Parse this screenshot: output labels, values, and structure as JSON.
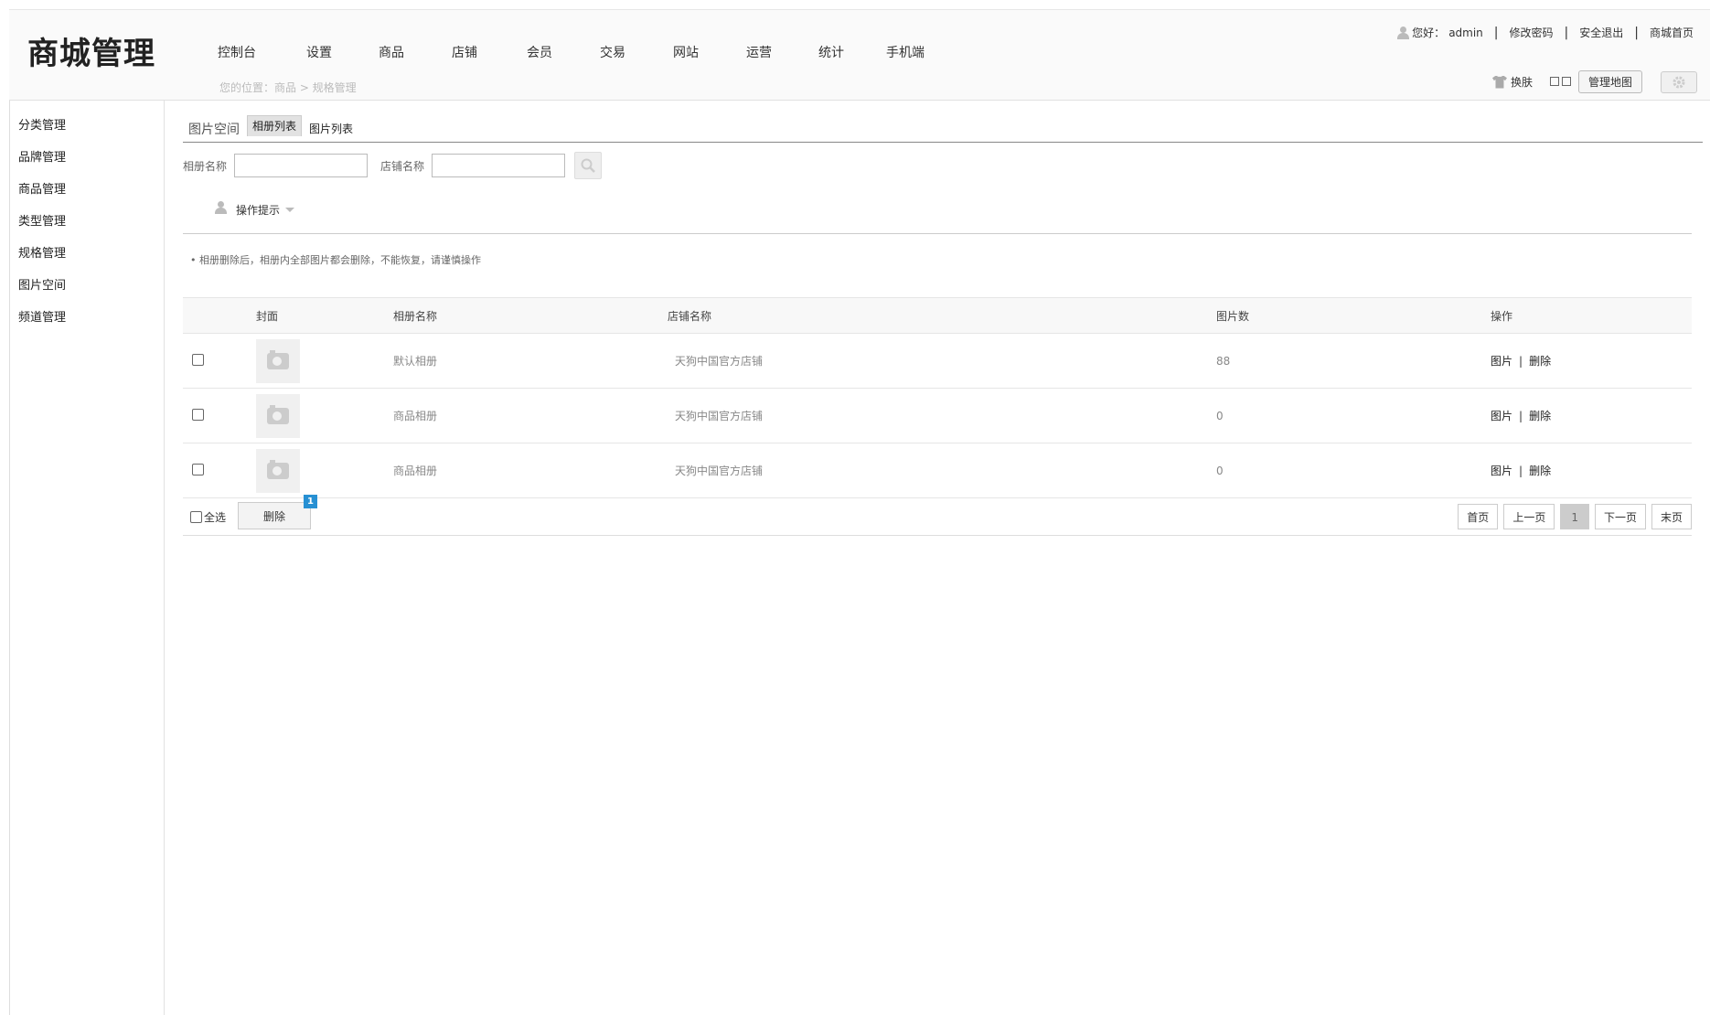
{
  "header": {
    "logo": "商城管理",
    "nav": [
      "控制台",
      "设置",
      "商品",
      "店铺",
      "会员",
      "交易",
      "网站",
      "运营",
      "统计",
      "手机端"
    ],
    "breadcrumb": "您的位置：商品 > 规格管理",
    "greeting": "您好：",
    "username": "admin",
    "change_password": "修改密码",
    "logout": "安全退出",
    "store_home": "商城首页",
    "skin_label": "换肤",
    "map_button": "管理地图"
  },
  "sidebar": {
    "items": [
      "分类管理",
      "品牌管理",
      "商品管理",
      "类型管理",
      "规格管理",
      "图片空间",
      "频道管理"
    ]
  },
  "main": {
    "section_title": "图片空间",
    "tabs": [
      "相册列表",
      "图片列表"
    ],
    "search": {
      "album_label": "相册名称",
      "store_label": "店铺名称",
      "album_value": "",
      "store_value": ""
    },
    "hint_title": "操作提示",
    "notice": "相册删除后，相册内全部图片都会删除，不能恢复，请谨慎操作",
    "table": {
      "headers": [
        "封面",
        "相册名称",
        "店铺名称",
        "图片数",
        "操作"
      ],
      "rows": [
        {
          "name": "默认相册",
          "store": "天狗中国官方店铺",
          "count": "88",
          "op_view": "图片",
          "op_delete": "删除"
        },
        {
          "name": "商品相册",
          "store": "天狗中国官方店铺",
          "count": "0",
          "op_view": "图片",
          "op_delete": "删除"
        },
        {
          "name": "商品相册",
          "store": "天狗中国官方店铺",
          "count": "0",
          "op_view": "图片",
          "op_delete": "删除"
        }
      ]
    },
    "footer": {
      "select_all": "全选",
      "delete": "删除",
      "badge": "1"
    },
    "pager": {
      "first": "首页",
      "prev": "上一页",
      "current": "1",
      "next": "下一页",
      "last": "末页"
    }
  }
}
